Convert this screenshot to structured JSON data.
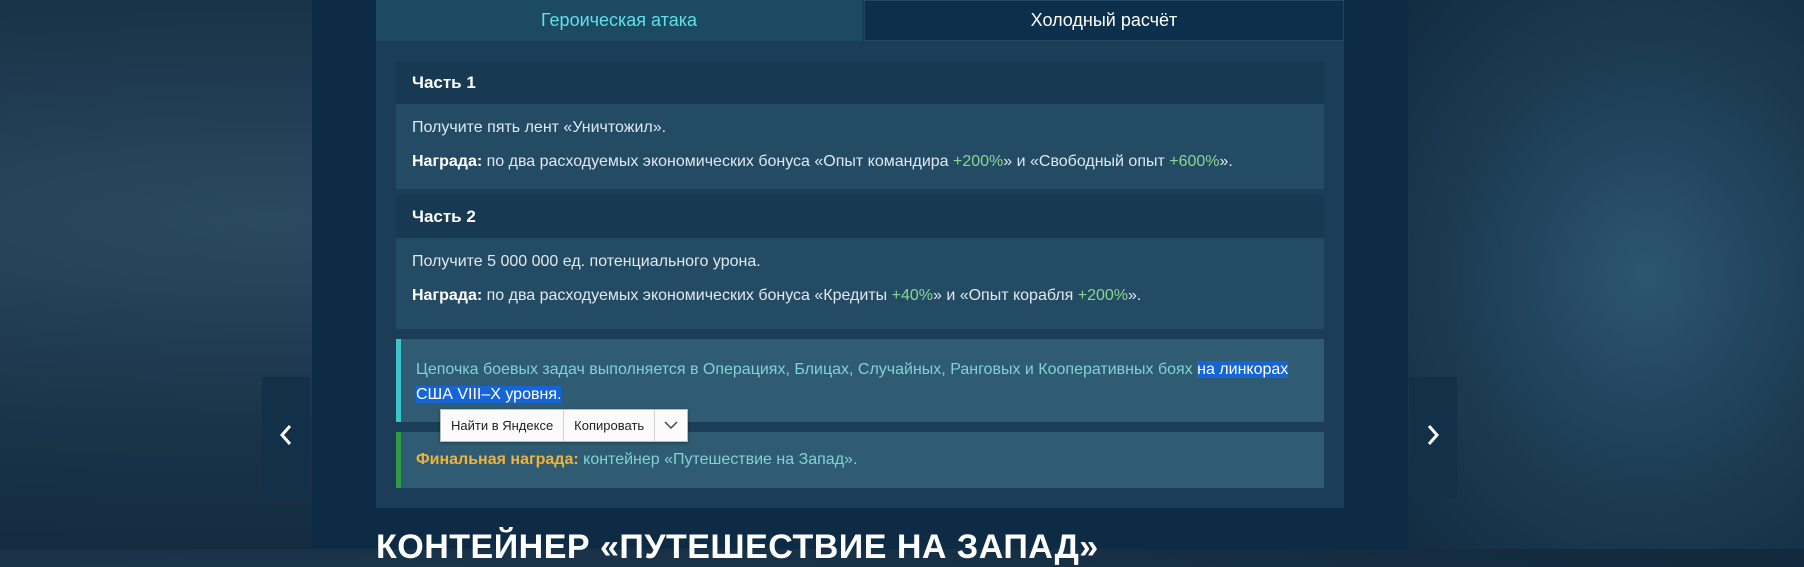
{
  "tabs": [
    {
      "label": "Героическая атака",
      "active": true
    },
    {
      "label": "Холодный расчёт",
      "active": false
    }
  ],
  "parts": [
    {
      "title": "Часть 1",
      "task": "Получите пять лент «Уничтожил».",
      "reward_label": "Награда:",
      "reward_before": " по два расходуемых экономических бонуса «Опыт командира ",
      "bonus1": "+200%",
      "reward_middle": "» и «Свободный опыт ",
      "bonus2": "+600%",
      "reward_after": "»."
    },
    {
      "title": "Часть 2",
      "task": "Получите 5 000 000 ед. потенциального урона.",
      "reward_label": "Награда:",
      "reward_before": " по два расходуемых экономических бонуса «Кредиты ",
      "bonus1": "+40%",
      "reward_middle": "» и «Опыт корабля ",
      "bonus2": "+200%",
      "reward_after": "»."
    }
  ],
  "chain_note": {
    "text_plain": "Цепочка боевых задач выполняется в Операциях, Блицах, Случайных, Ранговых и Кооперативных боях ",
    "text_selected": "на линкорах США VIII–X уровня."
  },
  "final_reward": {
    "label": "Финальная награда:",
    "text": " контейнер «Путешествие на Запад»."
  },
  "context_menu": {
    "search_label": "Найти в Яндексе",
    "copy_label": "Копировать"
  },
  "section_heading": "КОНТЕЙНЕР «ПУТЕШЕСТВИЕ НА ЗАПАД»",
  "colors": {
    "accent_cyan": "#5fe0e6",
    "bonus_green": "#8ad690",
    "final_label_orange": "#f0b33a",
    "selection_blue": "#1565d8"
  },
  "icons": {
    "prev": "chevron-left-icon",
    "next": "chevron-right-icon",
    "menu_more": "chevron-down-icon"
  }
}
